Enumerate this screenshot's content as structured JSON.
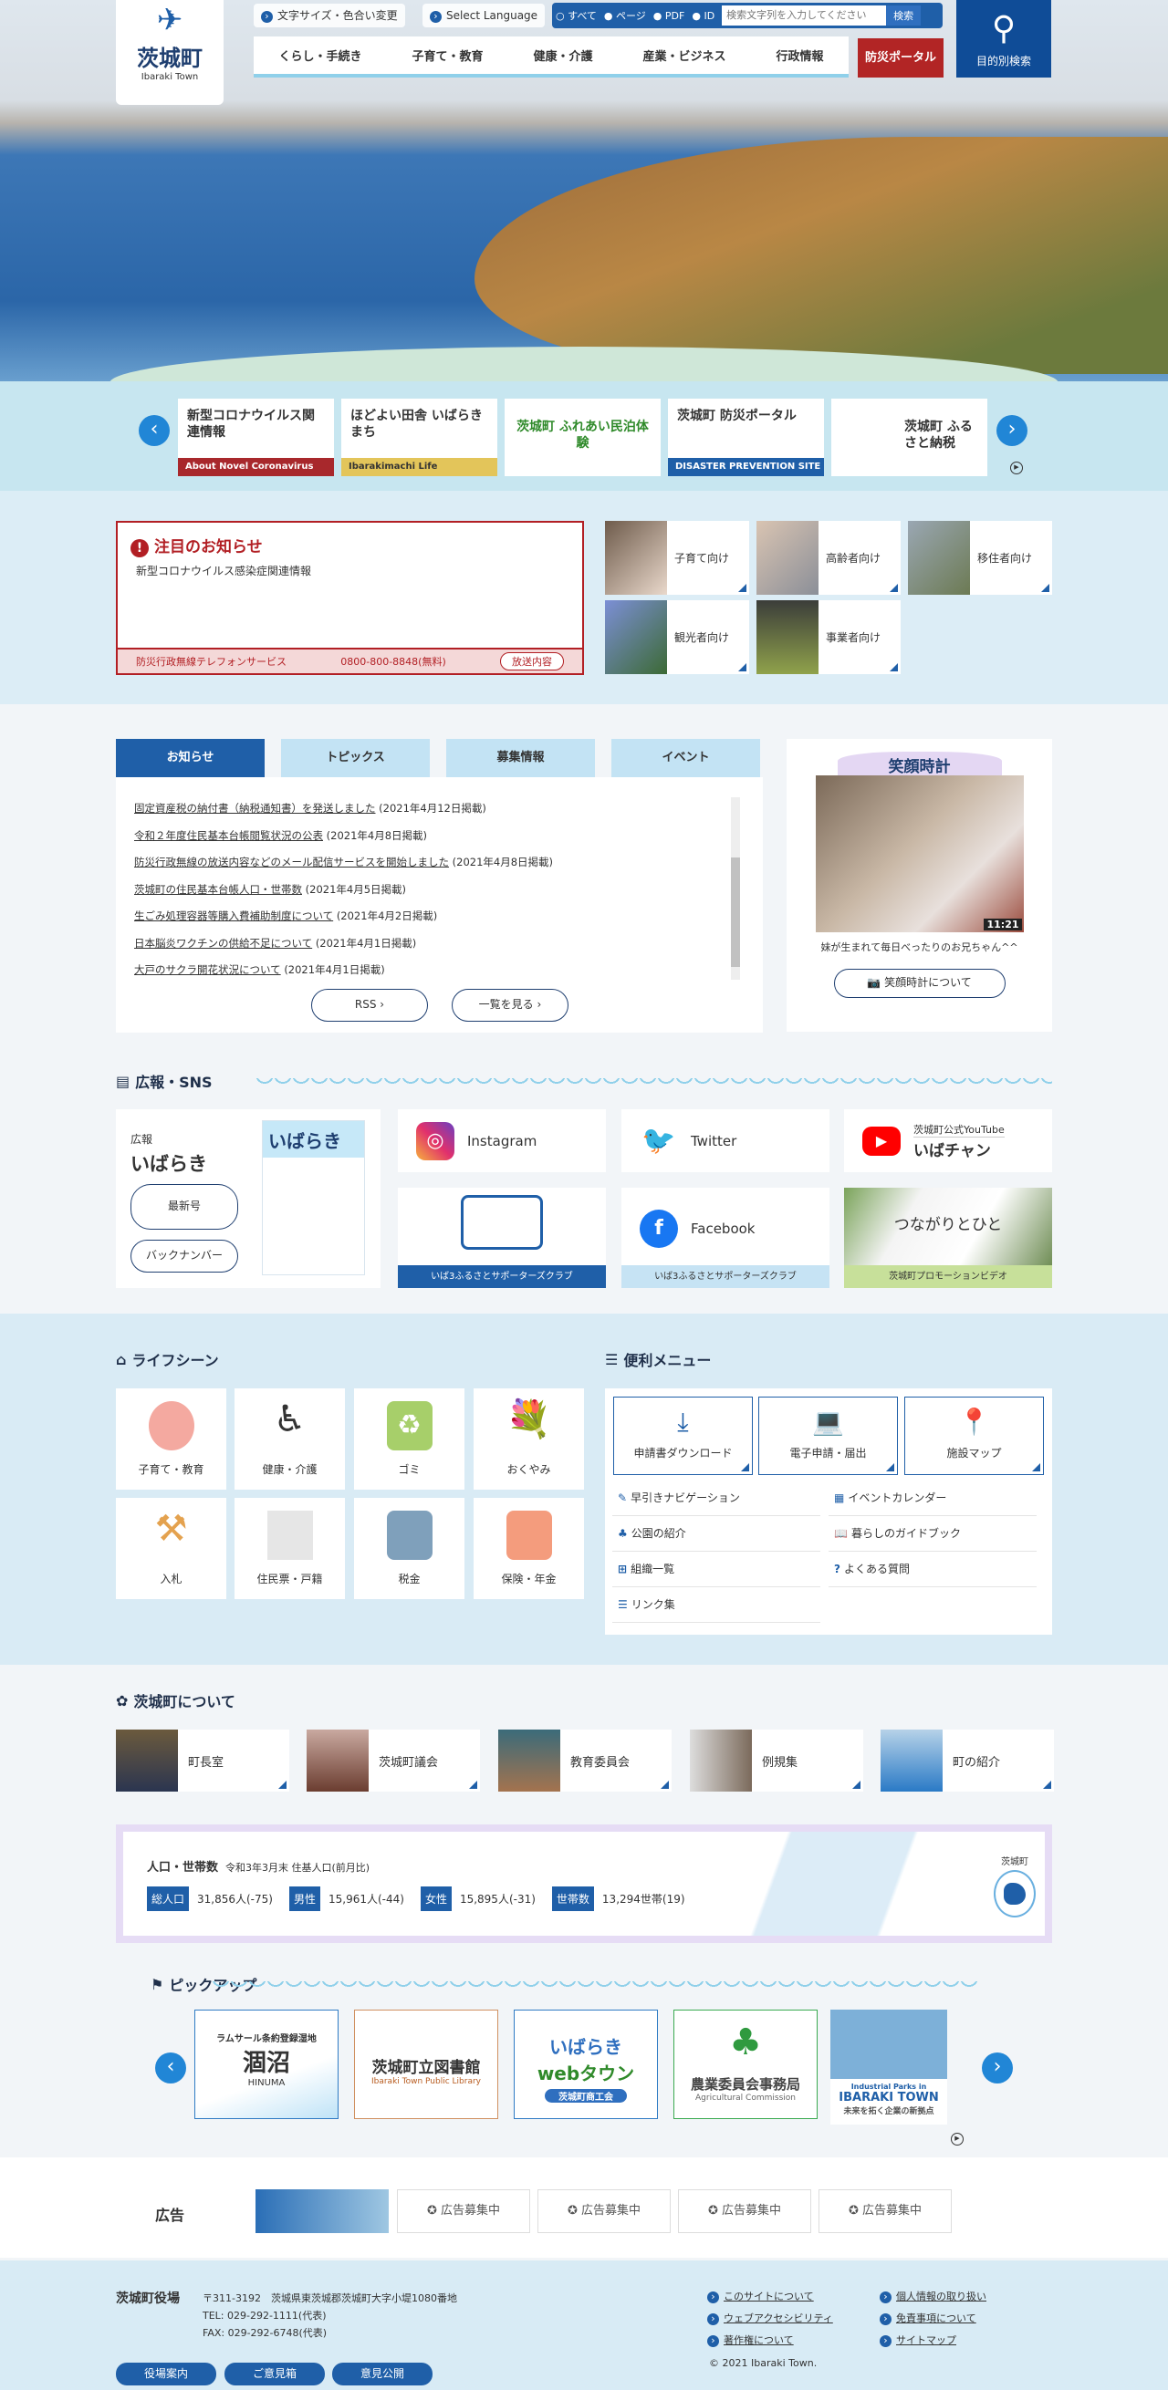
{
  "header": {
    "logo_jp": "茨城町",
    "logo_en": "Ibaraki Town",
    "text_size": "文字サイズ・色合い変更",
    "language": "Select Language",
    "search": {
      "options": [
        "すべて",
        "ページ",
        "PDF",
        "ID"
      ],
      "placeholder": "検索文字列を入力してください",
      "button": "検索"
    },
    "nav": [
      "くらし・手続き",
      "子育て・教育",
      "健康・介護",
      "産業・ビジネス",
      "行政情報"
    ],
    "bosai": "防災ポータル",
    "mokuteki": "目的別検索"
  },
  "banners": [
    {
      "title": "新型コロナウイルス関連情報",
      "footer": "About Novel Coronavirus",
      "color": "#a8282c"
    },
    {
      "title": "ほどよい田舎 いばらきまち",
      "footer": "Ibarakimachi Life",
      "color": "#e3c55a"
    },
    {
      "title": "茨城町 ふれあい民泊体験",
      "footer": "",
      "color": "#2f8a2a"
    },
    {
      "title": "茨城町 防災ポータル",
      "footer": "DISASTER PREVENTION SITE",
      "color": "#1f5fa8"
    },
    {
      "title": "茨城町 ふるさと納税",
      "footer": "",
      "color": "#2f8a2a"
    }
  ],
  "notice": {
    "title": "注目のお知らせ",
    "link": "新型コロナウイルス感染症関連情報",
    "tel_label": "防災行政無線テレフォンサービス",
    "tel": "0800-800-8848(無料)",
    "tel_button": "放送内容"
  },
  "targets": [
    "子育て向け",
    "高齢者向け",
    "移住者向け",
    "観光者向け",
    "事業者向け"
  ],
  "news": {
    "tabs": [
      "お知らせ",
      "トピックス",
      "募集情報",
      "イベント"
    ],
    "items": [
      {
        "t": "固定資産税の納付書（納税通知書）を発送しました",
        "d": "(2021年4月12日掲載)"
      },
      {
        "t": "令和２年度住民基本台帳閲覧状況の公表",
        "d": "(2021年4月8日掲載)"
      },
      {
        "t": "防災行政無線の放送内容などのメール配信サービスを開始しました",
        "d": "(2021年4月8日掲載)"
      },
      {
        "t": "茨城町の住民基本台帳人口・世帯数",
        "d": "(2021年4月5日掲載)"
      },
      {
        "t": "生ごみ処理容器等購入費補助制度について",
        "d": "(2021年4月2日掲載)"
      },
      {
        "t": "日本脳炎ワクチンの供給不足について",
        "d": "(2021年4月1日掲載)"
      },
      {
        "t": "大戸のサクラ開花状況について",
        "d": "(2021年4月1日掲載)"
      }
    ],
    "rss": "RSS",
    "list": "一覧を見る"
  },
  "smile": {
    "title": "笑顔時計",
    "time": "11:21",
    "caption": "妹が生まれて毎日べったりのお兄ちゃん^^",
    "button": "笑顔時計について"
  },
  "sns": {
    "heading": "広報・SNS",
    "koho_small": "広報",
    "koho_big": "いばらき",
    "mag_title": "いばらき",
    "latest": "最新号",
    "backnumber": "バックナンバー",
    "instagram": "Instagram",
    "twitter": "Twitter",
    "youtube_top": "茨城町公式YouTube",
    "youtube": "いばチャン",
    "iba3": "いば3ふるさとサポーターズクラブ",
    "facebook": "Facebook",
    "facebook_foot": "いば3ふるさとサポーターズクラブ",
    "promo": "つながりとひと",
    "promo_foot": "茨城町プロモーションビデオ"
  },
  "life": {
    "heading": "ライフシーン",
    "items": [
      "子育て・教育",
      "健康・介護",
      "ゴミ",
      "おくやみ",
      "入札",
      "住民票・戸籍",
      "税金",
      "保険・年金"
    ]
  },
  "menu": {
    "heading": "便利メニュー",
    "big": [
      "申請書ダウンロード",
      "電子申請・届出",
      "施設マップ"
    ],
    "links": [
      "早引きナビゲーション",
      "イベントカレンダー",
      "公園の紹介",
      "暮らしのガイドブック",
      "組織一覧",
      "よくある質問",
      "リンク集"
    ]
  },
  "about": {
    "heading": "茨城町について",
    "items": [
      "町長室",
      "茨城町議会",
      "教育委員会",
      "例規集",
      "町の紹介"
    ]
  },
  "population": {
    "title": "人口・世帯数",
    "note": "令和3年3月末 住基人口(前月比)",
    "map_label": "茨城町",
    "stats": [
      {
        "label": "総人口",
        "value": "31,856人(-75)"
      },
      {
        "label": "男性",
        "value": "15,961人(-44)"
      },
      {
        "label": "女性",
        "value": "15,895人(-31)"
      },
      {
        "label": "世帯数",
        "value": "13,294世帯(19)"
      }
    ]
  },
  "pickup": {
    "heading": "ピックアップ",
    "items": [
      {
        "a": "ラムサール条約登録湿地",
        "b": "涸沼",
        "c": "HINUMA"
      },
      {
        "a": "",
        "b": "茨城町立図書館",
        "c": "Ibaraki Town Public Library"
      },
      {
        "a": "いばらき",
        "b": "webタウン",
        "c": "茨城町商工会"
      },
      {
        "a": "",
        "b": "農業委員会事務局",
        "c": "Agricultural Commission"
      },
      {
        "a": "Industrial Parks in",
        "b": "IBARAKI TOWN",
        "c": "未来を拓く企業の新拠点"
      }
    ]
  },
  "ads": {
    "heading": "広告",
    "slot": "広告募集中"
  },
  "footer": {
    "name": "茨城町役場",
    "address": "〒311-3192　茨城県東茨城郡茨城町大字小堤1080番地",
    "tel": "TEL: 029-292-1111(代表)",
    "fax": "FAX: 029-292-6748(代表)",
    "buttons": [
      "役場案内",
      "ご意見箱",
      "意見公開"
    ],
    "links": [
      "このサイトについて",
      "個人情報の取り扱い",
      "ウェブアクセシビリティ",
      "免責事項について",
      "著作権について",
      "サイトマップ"
    ],
    "copyright": "© 2021 Ibaraki Town."
  }
}
